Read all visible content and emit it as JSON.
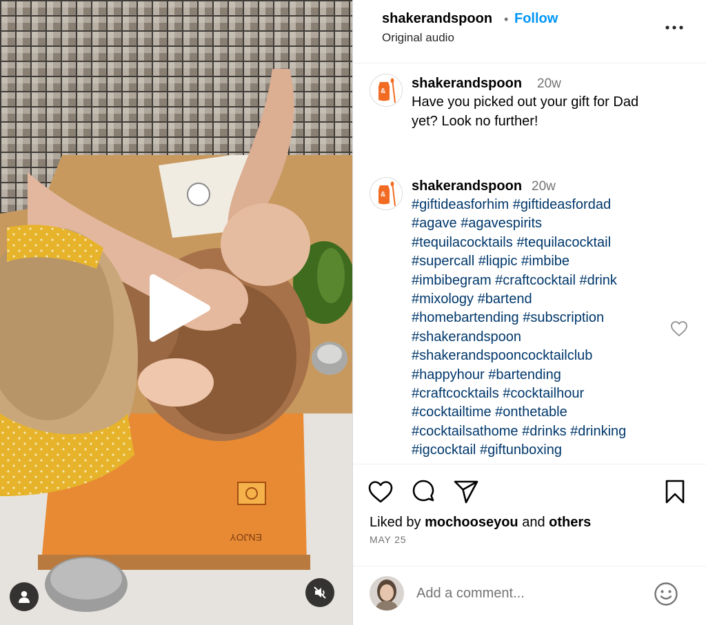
{
  "post": {
    "username": "shakerandspoon",
    "separator": "•",
    "follow_label": "Follow",
    "audio_label": "Original audio",
    "more_icon": "more-horizontal-icon"
  },
  "comments": [
    {
      "username": "shakerandspoon",
      "time": "20w",
      "text": "Have you picked out your gift for Dad yet? Look no further!"
    },
    {
      "username": "shakerandspoon",
      "time": "20w",
      "hashtags": [
        "#giftideasforhim",
        "#giftideasfordad",
        "#agave",
        "#agavespirits",
        "#tequilacocktails",
        "#tequilacocktail",
        "#supercall",
        "#liqpic",
        "#imbibe",
        "#imbibegram",
        "#craftcocktail",
        "#drink",
        "#mixology",
        "#bartend",
        "#homebartending",
        "#subscription",
        "#shakerandspoon",
        "#shakerandspooncocktailclub",
        "#happyhour",
        "#bartending",
        "#craftcocktails",
        "#cocktailhour",
        "#cocktailtime",
        "#onthetable",
        "#cocktailsathome",
        "#drinks",
        "#drinking",
        "#igcocktail",
        "#giftunboxing"
      ]
    }
  ],
  "actions": {
    "like_icon": "heart-icon",
    "comment_icon": "comment-bubble-icon",
    "share_icon": "send-icon",
    "save_icon": "bookmark-icon"
  },
  "likes": {
    "prefix": "Liked by",
    "user": "mochooseyou",
    "connector": "and",
    "others": "others"
  },
  "date": "MAY 25",
  "comment_box": {
    "placeholder": "Add a comment...",
    "emoji_icon": "emoji-smile-icon"
  },
  "colors": {
    "follow_blue": "#0095f6",
    "hashtag_blue": "#00376b",
    "brand_orange": "#f26b22",
    "muted_text": "#737373"
  }
}
